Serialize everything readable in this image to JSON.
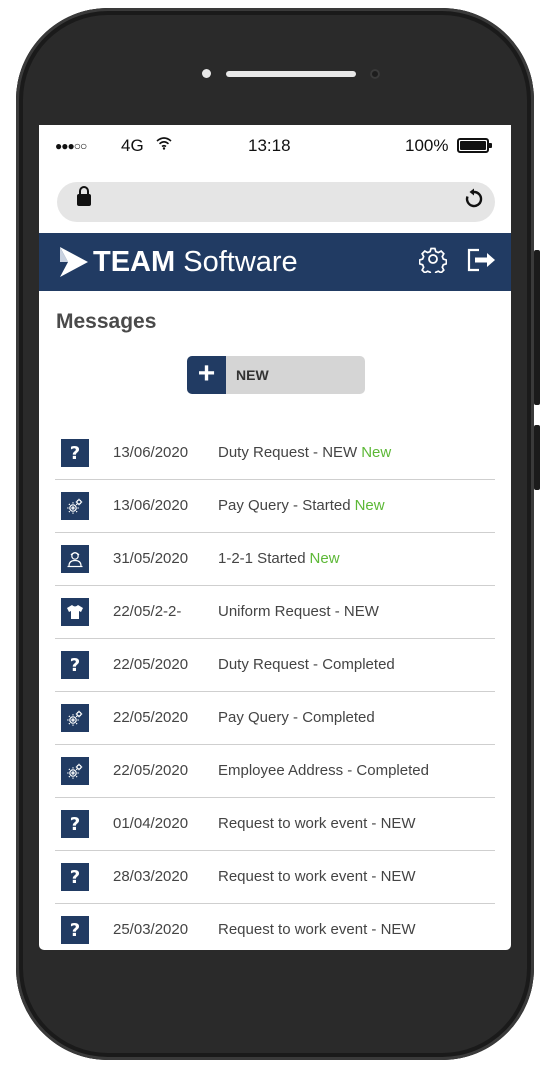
{
  "status_bar": {
    "signal": "●●●○○",
    "network": "4G",
    "wifi_icon": "wifi-icon",
    "time": "13:18",
    "battery": "100%"
  },
  "browser": {
    "lock_icon": "lock-icon",
    "reload_icon": "reload-icon"
  },
  "app_bar": {
    "brand_bold": "TEAM",
    "brand_light": "Software",
    "settings_icon": "gear-icon",
    "logout_icon": "logout-icon",
    "color": "#213b63"
  },
  "page": {
    "title": "Messages",
    "new_button_label": "NEW"
  },
  "accent_new_color": "#5cb836",
  "messages": [
    {
      "icon": "question-icon",
      "glyph": "?",
      "date": "13/06/2020",
      "subject": "Duty Request - NEW",
      "tag": "New"
    },
    {
      "icon": "gears-icon",
      "glyph": "⚙",
      "date": "13/06/2020",
      "subject": "Pay Query - Started",
      "tag": "New"
    },
    {
      "icon": "person-icon",
      "glyph": "☺",
      "date": "31/05/2020",
      "subject": "1-2-1 Started",
      "tag": "New"
    },
    {
      "icon": "tshirt-icon",
      "glyph": "👕",
      "date": "22/05/2-2-",
      "subject": "Uniform Request - NEW",
      "tag": ""
    },
    {
      "icon": "question-icon",
      "glyph": "?",
      "date": "22/05/2020",
      "subject": "Duty Request - Completed",
      "tag": ""
    },
    {
      "icon": "gears-icon",
      "glyph": "⚙",
      "date": "22/05/2020",
      "subject": "Pay Query - Completed",
      "tag": ""
    },
    {
      "icon": "gears-icon",
      "glyph": "⚙",
      "date": "22/05/2020",
      "subject": "Employee Address - Completed",
      "tag": ""
    },
    {
      "icon": "question-icon",
      "glyph": "?",
      "date": "01/04/2020",
      "subject": "Request to work event - NEW",
      "tag": ""
    },
    {
      "icon": "question-icon",
      "glyph": "?",
      "date": "28/03/2020",
      "subject": "Request to work event - NEW",
      "tag": ""
    },
    {
      "icon": "question-icon",
      "glyph": "?",
      "date": "25/03/2020",
      "subject": "Request to work event - NEW",
      "tag": ""
    }
  ]
}
